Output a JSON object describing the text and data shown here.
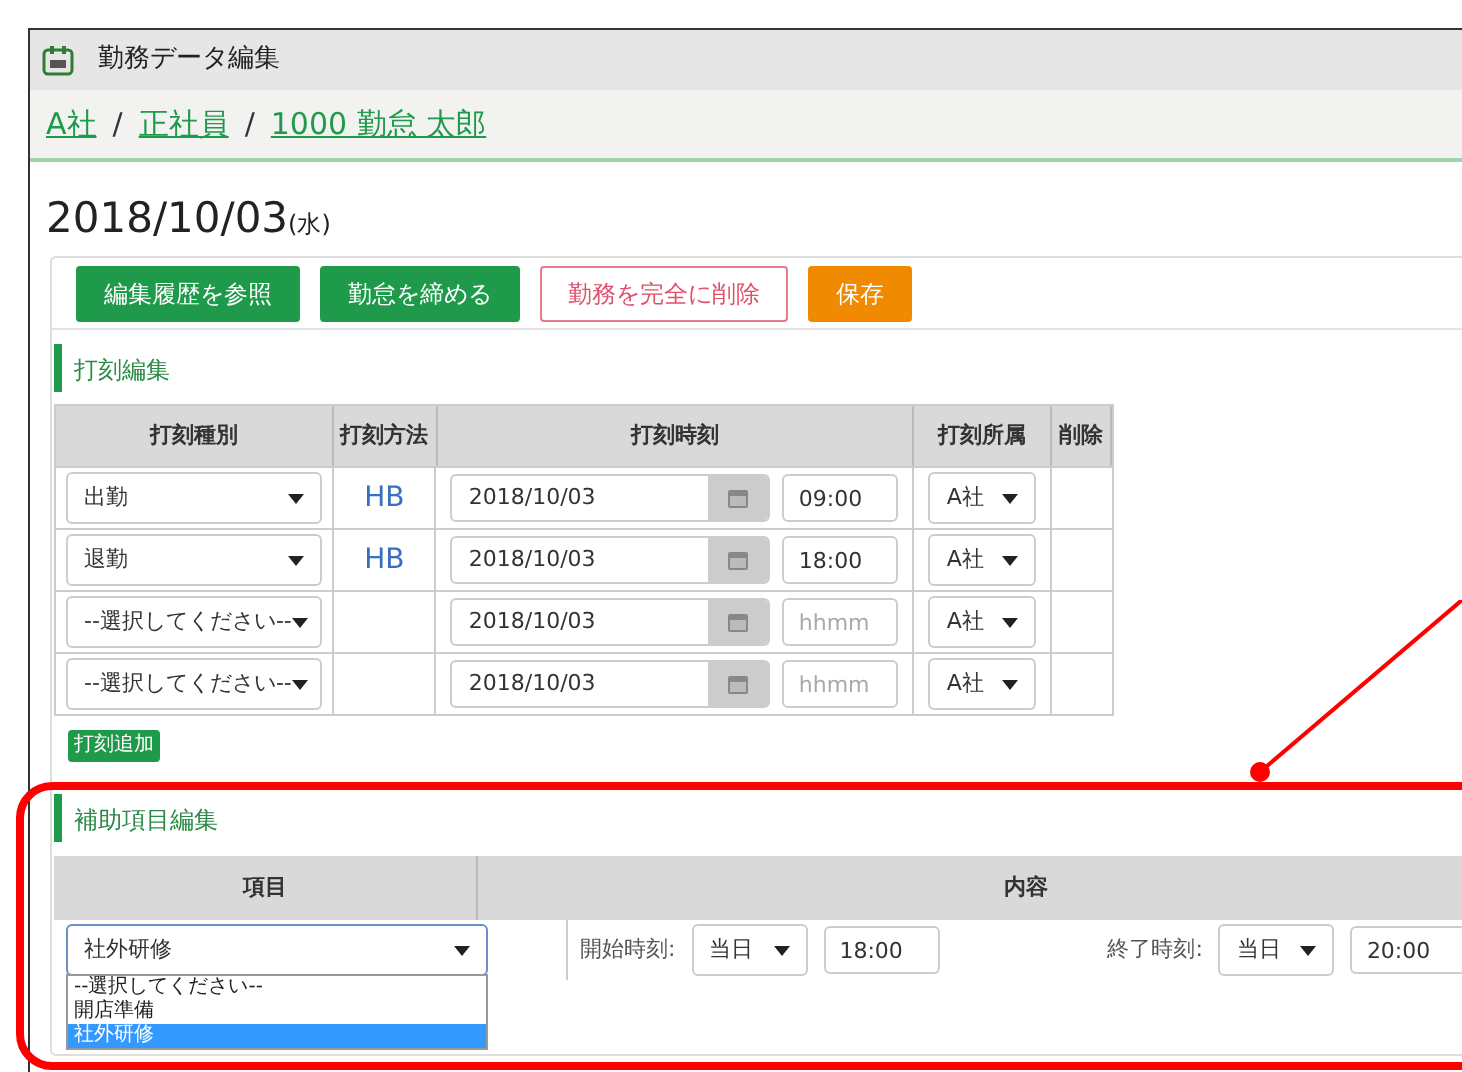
{
  "window": {
    "title": "勤務データ編集"
  },
  "breadcrumb": [
    "A社",
    "正社員",
    "1000 勤怠 太郎"
  ],
  "breadcrumb_separator": "/",
  "date": {
    "text": "2018/10/03",
    "weekday": "(水)"
  },
  "buttons": [
    {
      "label": "編集履歴を参照",
      "kind": "primary"
    },
    {
      "label": "勤怠を締める",
      "kind": "primary"
    },
    {
      "label": "勤務を完全に削除",
      "kind": "danger"
    },
    {
      "label": "保存",
      "kind": "warning"
    }
  ],
  "stamp_section": {
    "title": "打刻編集",
    "columns": [
      "打刻種別",
      "打刻方法",
      "打刻時刻",
      "打刻所属",
      "削除"
    ],
    "rows": [
      {
        "type": "出勤",
        "method": "HB",
        "date": "2018/10/03",
        "time": "09:00",
        "affiliation": "A社"
      },
      {
        "type": "退勤",
        "method": "HB",
        "date": "2018/10/03",
        "time": "18:00",
        "affiliation": "A社"
      },
      {
        "type": "--選択してください--",
        "date": "2018/10/03",
        "time_placeholder": "hhmm",
        "affiliation": "A社"
      },
      {
        "type": "--選択してください--",
        "date": "2018/10/03",
        "time_placeholder": "hhmm",
        "affiliation": "A社"
      }
    ],
    "add_button": "打刻追加"
  },
  "aux_section": {
    "title": "補助項目編集",
    "columns": [
      "項目",
      "内容"
    ],
    "row": {
      "item": "社外研修",
      "start_label": "開始時刻:",
      "start_day": "当日",
      "start_time": "18:00",
      "end_label": "終了時刻:",
      "end_day": "当日",
      "end_time": "20:00"
    },
    "dropdown_options": [
      {
        "label": "--選択してください--",
        "selected": false
      },
      {
        "label": "開店準備",
        "selected": false
      },
      {
        "label": "社外研修",
        "selected": true
      }
    ]
  }
}
